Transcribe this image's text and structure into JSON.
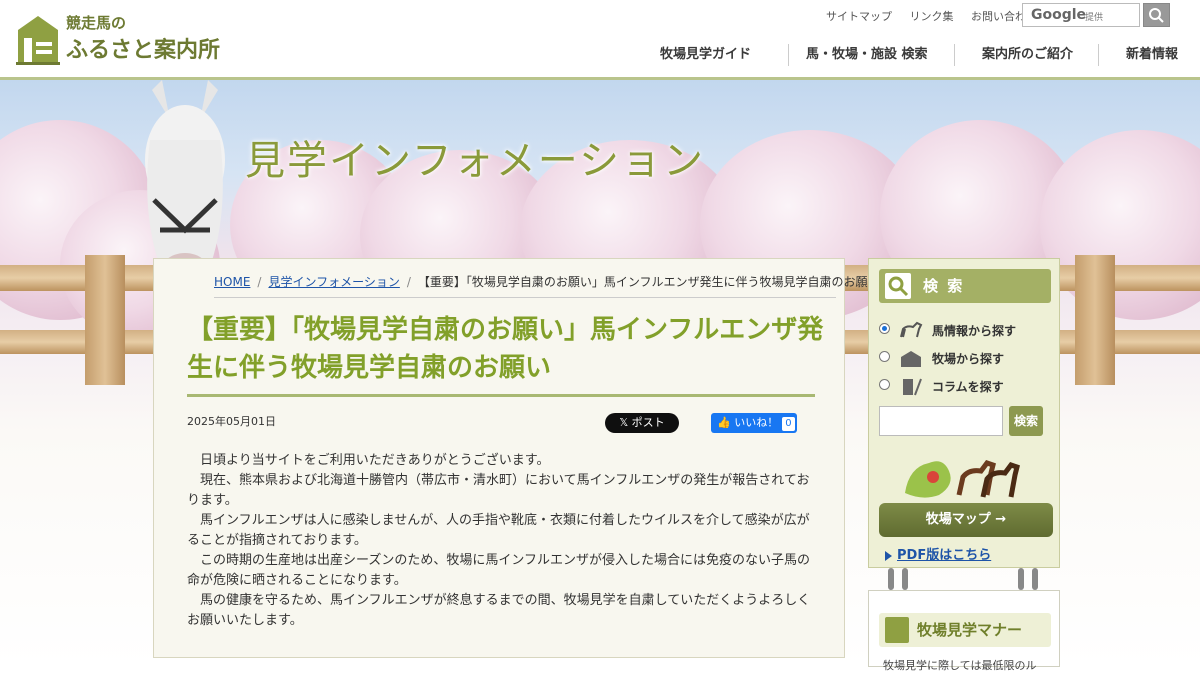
{
  "site": {
    "logo_line1": "競走馬の",
    "logo_line2": "ふるさと案内所"
  },
  "utility_links": [
    "サイトマップ",
    "リンク集",
    "お問い合わせ"
  ],
  "site_search": {
    "google_word": "Google",
    "google_suffix": "提供"
  },
  "nav": [
    "牧場見学ガイド",
    "馬・牧場・施設 検索",
    "案内所のご紹介",
    "新着情報"
  ],
  "hero": {
    "title": "見学インフォメーション"
  },
  "breadcrumb": {
    "home": "HOME",
    "section": "見学インフォメーション",
    "current": "【重要】「牧場見学自粛のお願い」馬インフルエンザ発生に伴う牧場見学自粛のお願い"
  },
  "article": {
    "title": "【重要】「牧場見学自粛のお願い」馬インフルエンザ発生に伴う牧場見学自粛のお願い",
    "date": "2025年05月01日",
    "x_post_label": "𝕏 ポスト",
    "like_label": "👍 いいね！",
    "like_count": "0",
    "paragraphs": [
      "日頃より当サイトをご利用いただきありがとうございます。",
      "現在、熊本県および北海道十勝管内（帯広市・清水町）において馬インフルエンザの発生が報告されております。",
      "馬インフルエンザは人に感染しませんが、人の手指や靴底・衣類に付着したウイルスを介して感染が広がることが指摘されております。",
      "この時期の生産地は出産シーズンのため、牧場に馬インフルエンザが侵入した場合には免疫のない子馬の命が危険に晒されることになります。",
      "馬の健康を守るため、馬インフルエンザが終息するまでの間、牧場見学を自粛していただくようよろしくお願いいたします。"
    ]
  },
  "sidebar": {
    "search_title": "検 索",
    "options": [
      {
        "label": "馬情報から探す",
        "icon": "horse-icon",
        "checked": true
      },
      {
        "label": "牧場から探す",
        "icon": "barn-icon",
        "checked": false
      },
      {
        "label": "コラムを探す",
        "icon": "pen-icon",
        "checked": false
      }
    ],
    "search_button": "検索",
    "ranch_map_button": "牧場マップ →",
    "pdf_link": "PDF版はこちら",
    "manners_title": "牧場見学マナー",
    "manners_text": "牧場見学に際しては最低限のル"
  },
  "colors": {
    "accent_green": "#82a02a",
    "sidebar_bg": "#eef0d6",
    "link_blue": "#1e54a8"
  }
}
